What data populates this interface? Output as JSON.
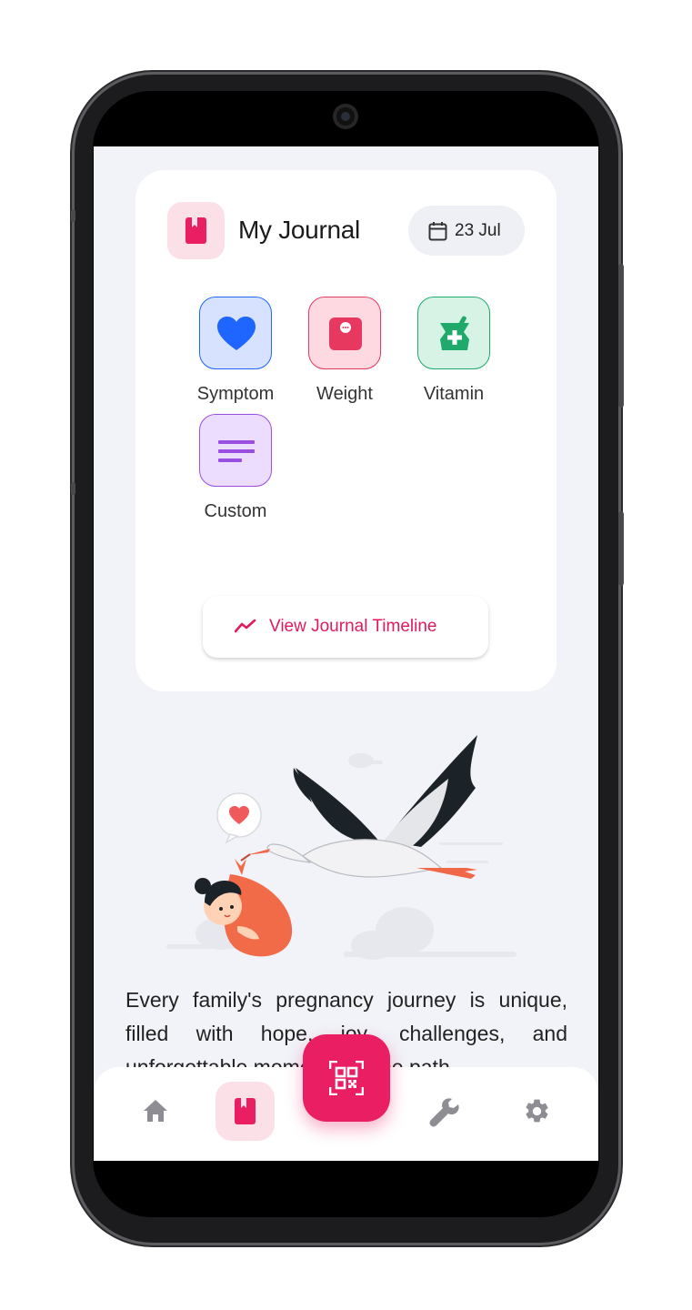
{
  "journal": {
    "title": "My Journal",
    "date": "23 Jul",
    "tiles": [
      {
        "label": "Symptom",
        "icon": "heart-icon",
        "color": "#1e66ff"
      },
      {
        "label": "Weight",
        "icon": "scale-icon",
        "color": "#e7385f"
      },
      {
        "label": "Vitamin",
        "icon": "pill-bottle-icon",
        "color": "#1faa6b"
      },
      {
        "label": "Custom",
        "icon": "notes-icon",
        "color": "#9b4fe0"
      }
    ],
    "timeline_button": "View Journal Timeline"
  },
  "intro_text": "Every family's pregnancy journey is unique, filled with hope, joy, challenges, and unforgettable moments on the path",
  "bottom_nav": {
    "items": [
      {
        "icon": "home-icon"
      },
      {
        "icon": "journal-icon",
        "active": true
      },
      {
        "icon": "qr-scan-icon"
      },
      {
        "icon": "wrench-icon"
      },
      {
        "icon": "gear-icon"
      }
    ]
  },
  "colors": {
    "accent": "#e91e63",
    "background": "#f1f3f8"
  }
}
